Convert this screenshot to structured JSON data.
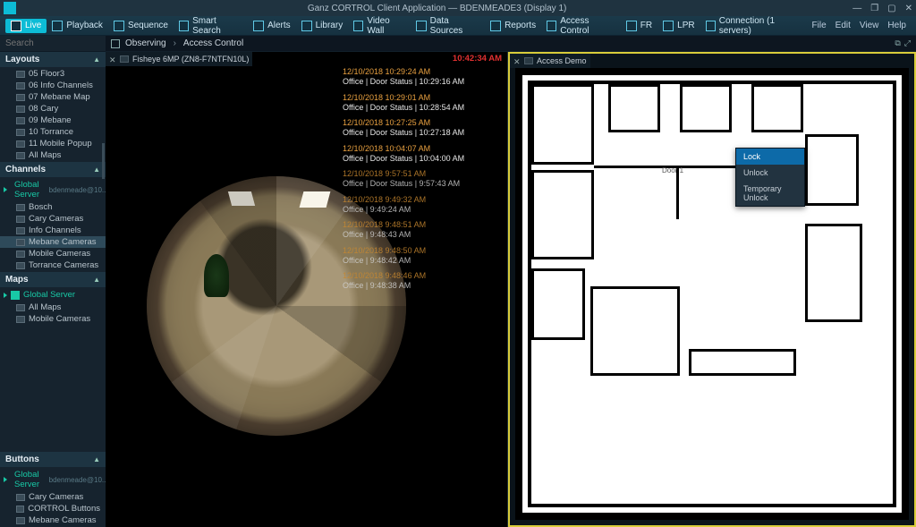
{
  "window": {
    "title": "Ganz CORTROL Client Application — BDENMEADE3 (Display 1)"
  },
  "ribbon": {
    "live": "Live",
    "playback": "Playback",
    "sequence": "Sequence",
    "smart_search": "Smart Search",
    "alerts": "Alerts",
    "library": "Library",
    "video_wall": "Video Wall",
    "data_sources": "Data Sources",
    "reports": "Reports",
    "access_control": "Access Control",
    "fr": "FR",
    "lpr": "LPR",
    "connection": "Connection (1 servers)",
    "menu": {
      "file": "File",
      "edit": "Edit",
      "view": "View",
      "help": "Help"
    }
  },
  "search": {
    "placeholder": "Search"
  },
  "sections": {
    "layouts": "Layouts",
    "channels": "Channels",
    "maps": "Maps",
    "buttons": "Buttons"
  },
  "layouts_items": [
    "05 Floor3",
    "06 Info Channels",
    "07 Mebane Map",
    "08 Cary",
    "09 Mebane",
    "10 Torrance",
    "11 Mobile Popup",
    "All Maps"
  ],
  "server_label": "Global Server",
  "server_suffix": "bdenmeade@10...",
  "channels_items": [
    "Bosch",
    "Cary Cameras",
    "Info Channels",
    "Mebane Cameras",
    "Mobile Cameras",
    "Torrance Cameras"
  ],
  "channels_selected_index": 3,
  "maps_items": [
    "All Maps",
    "Mobile Cameras"
  ],
  "buttons_items": [
    "Cary Cameras",
    "CORTROL Buttons",
    "Mebane Cameras"
  ],
  "crumbs": {
    "a": "Observing",
    "b": "Access Control"
  },
  "camera_tab": "Fisheye 6MP (ZN8-F7NTFN10L)",
  "map_tab": "Access Demo",
  "live_timestamp": "10:42:34 AM",
  "events": [
    {
      "t": "12/10/2018 10:29:24 AM",
      "d": "Office | Door Status | 10:29:16 AM"
    },
    {
      "t": "12/10/2018 10:29:01 AM",
      "d": "Office | Door Status | 10:28:54 AM"
    },
    {
      "t": "12/10/2018 10:27:25 AM",
      "d": "Office | Door Status | 10:27:18 AM"
    },
    {
      "t": "12/10/2018 10:04:07 AM",
      "d": "Office | Door Status | 10:04:00 AM"
    },
    {
      "t": "12/10/2018 9:57:51 AM",
      "d": "Office | Door Status | 9:57:43 AM"
    },
    {
      "t": "12/10/2018 9:49:32 AM",
      "d": "Office | 9:49:24 AM"
    },
    {
      "t": "12/10/2018 9:48:51 AM",
      "d": "Office | 9:48:43 AM"
    },
    {
      "t": "12/10/2018 9:48:50 AM",
      "d": "Office | 9:48:42 AM"
    },
    {
      "t": "12/10/2018 9:48:46 AM",
      "d": "Office | 9:48:38 AM"
    }
  ],
  "door_label": "Door 1",
  "context_menu": {
    "items": [
      "Lock",
      "Unlock",
      "Temporary Unlock"
    ],
    "selected_index": 0
  }
}
